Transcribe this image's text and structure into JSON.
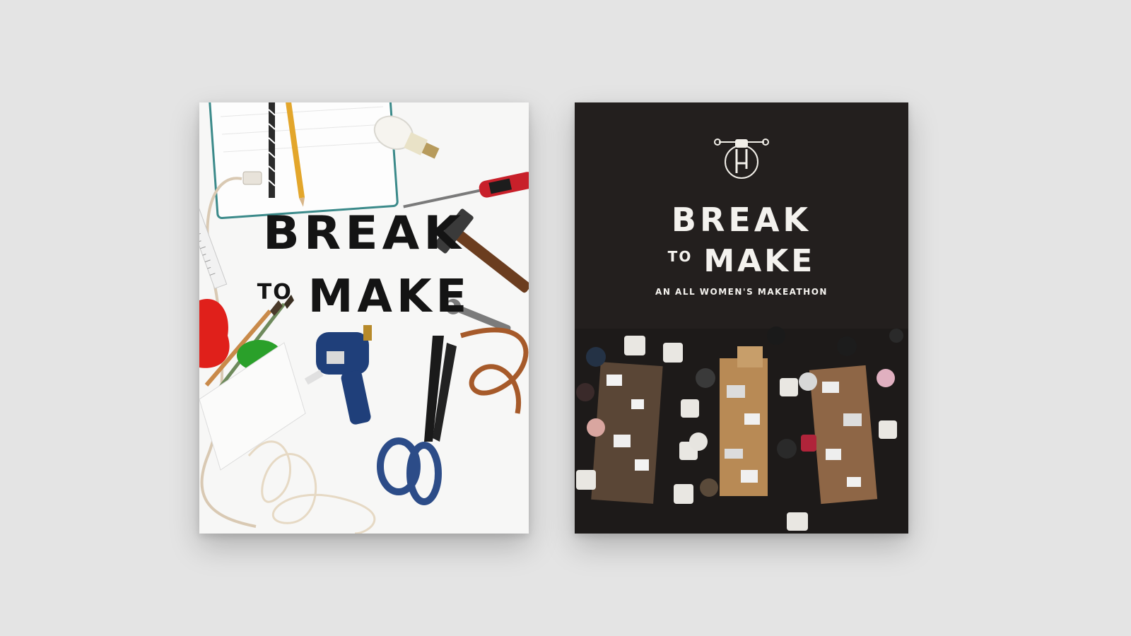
{
  "left_poster": {
    "title_line1": "BREAK",
    "title_to": "TO",
    "title_make": "MAKE"
  },
  "right_poster": {
    "logo_icon": "fist-wrench-logo-icon",
    "title_line1": "BREAK",
    "title_to": "TO",
    "title_make": "MAKE",
    "subtitle": "AN ALL WOMEN'S MAKEATHON"
  },
  "colors": {
    "background": "#e4e4e4",
    "left_poster_bg": "#f7f7f6",
    "right_poster_bg": "#231f1e",
    "title_dark": "#141414",
    "title_light": "#f4f2ee"
  }
}
